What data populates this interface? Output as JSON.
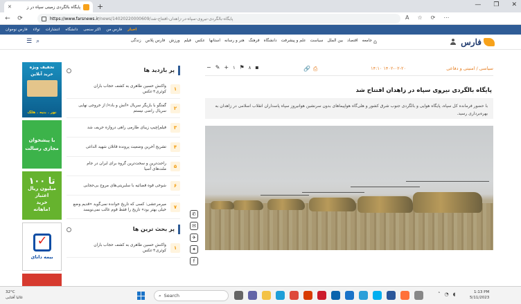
{
  "browser": {
    "tab_title": "پایگاه بالگردی زمینی سپاه در ز",
    "new_tab": "+",
    "url_domain": "https://www.farsnews.ir",
    "url_path": "/news/14020220000609/پایگاه-بالگردی-نیروی-سپاه-در-زاهدان-افتتاح-شد",
    "window_controls": [
      "—",
      "❐",
      "✕"
    ],
    "reader_label": "A",
    "tools": [
      "☆",
      "⟳",
      "⋯"
    ]
  },
  "topstrip": {
    "items": [
      "اخبار",
      "فارس من",
      "اکثر سنجی",
      "دانشگاه",
      "انتشارات",
      "تولاء",
      "فارس نوجوان"
    ]
  },
  "site": {
    "logo_text": "فارس",
    "menu": [
      "جامعه",
      "اقتصاد",
      "بین الملل",
      "سیاست",
      "علم و پیشرفت",
      "دانشگاه",
      "فرهنگ",
      "هنر و رسانه",
      "استانها",
      "عکس",
      "فیلم",
      "ورزش",
      "فارس پلاس",
      "زندگی"
    ]
  },
  "ads": {
    "ad1": {
      "line1": "تخفیف ویژه",
      "line2": "خرید آنلاین",
      "line3": "نور . بنیه . هلک"
    },
    "ad2": {
      "text": "با پیشخوان مجازی رسالت"
    },
    "ad3": {
      "big": "تا ۱۰۰",
      "line1": "میلیون ریال",
      "line2": "اعتبار",
      "line3": "خرید",
      "line4": "ماهانه!"
    },
    "ad4": {
      "text": "بیمه دانای"
    },
    "ad5": {
      "text": ""
    }
  },
  "sidebar": {
    "most_visited_title": "پر بازدید ها",
    "items": [
      {
        "num": "۱",
        "text": "واکنش حسین طاهری به کشف حجاب باران کوثری+عکس"
      },
      {
        "num": "۲",
        "text": "گفتگو با بازیگر سریال «آتش و باد»/ از خروجی نهایی سریال راضی نیستم"
      },
      {
        "num": "۳",
        "text": "فیلم|چیپ زیبای طارمی راهی دروازه حریف شد"
      },
      {
        "num": "۴",
        "text": "تشریح آخرین وضعیت پرونده قاتلان شهید الداغی"
      },
      {
        "num": "۵",
        "text": "راحت‌ترین و سخت‌ترین گروه برای ایران در جام ملت‌های آسیا"
      },
      {
        "num": "۶",
        "text": "شوخی قوه قضائیه با سلبریتی‌های مروج بی‌حجابی"
      },
      {
        "num": "۷",
        "text": "میرمرعشی: کسی که تاریخ خوانده نمی‌گوید «قدیم وضع خیلی بهتر بود» تاریخ را فقط قوم غالب نمی‌نویسد"
      }
    ],
    "most_discussed_title": "پر بحث ترین ها",
    "discussed_items": [
      {
        "num": "۱",
        "text": "واکنش حسین طاهری به کشف حجاب باران کوثری+عکس"
      }
    ]
  },
  "share": [
    "✆",
    "✉",
    "✈",
    "✦",
    "f"
  ],
  "article": {
    "category": "سیاسی / امنیتی و دفاعی",
    "date": "۱۴۰۲-۰۲-۲۰ ۱۴:۱۰",
    "comments": "۸",
    "likes": "۱",
    "headline": "پایگاه بالگردی نیروی سپاه در زاهدان افتتاح شد",
    "lead": "با حضور فرمانده کل سپاه، پایگاه هوایی و بالگردی جنوب شرق کشور و هلی‌گاه هواپیماهای بدون سرنشین هوانیروز سپاه پاسداران انقلاب اسلامی در زاهدان به بهره‌برداری رسید."
  },
  "taskbar": {
    "weather_temp": "32°C",
    "weather_desc": "غالبا آفتابی",
    "search_label": "Search",
    "time": "1:13 PM",
    "date": "5/11/2023"
  }
}
